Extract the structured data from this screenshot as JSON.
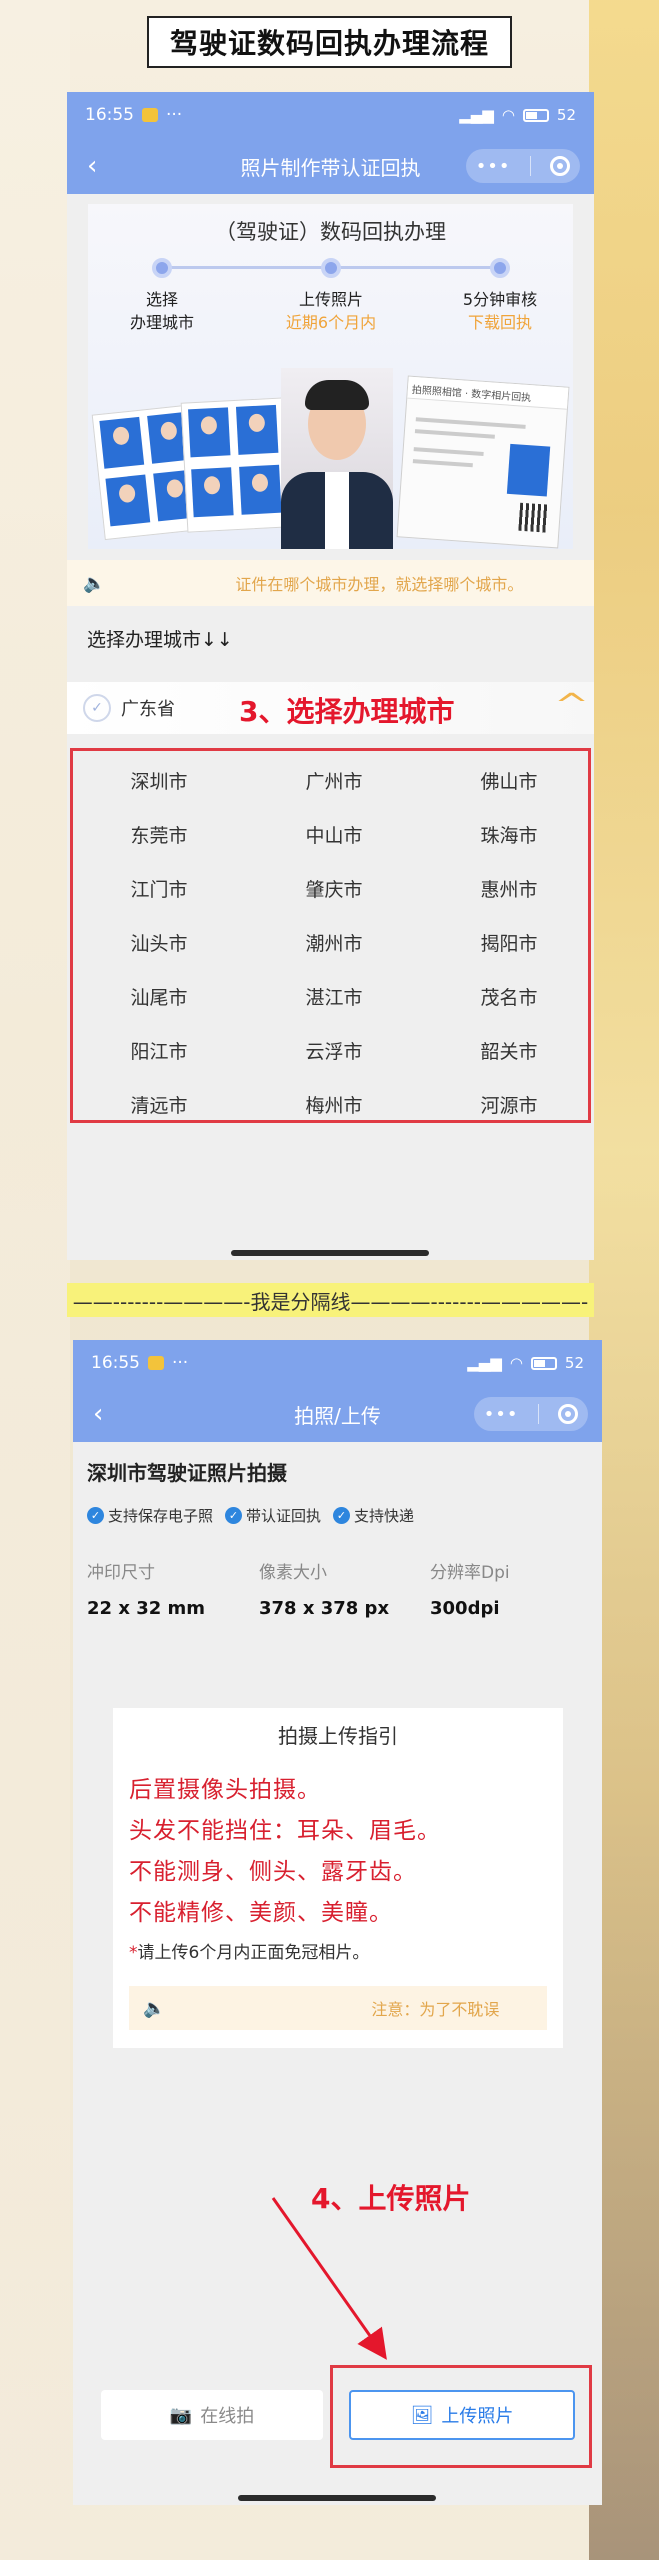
{
  "page_title": "驾驶证数码回执办理流程",
  "screen1": {
    "status": {
      "time": "16:55",
      "more": "···",
      "battery": "52"
    },
    "nav": {
      "back": "‹",
      "title": "照片制作带认证回执",
      "menu": "•••"
    },
    "banner": {
      "title": "（驾驶证）数码回执办理",
      "steps": [
        {
          "main": "选择",
          "sub_main": "办理城市",
          "sub_colored": ""
        },
        {
          "main": "上传照片",
          "sub_main": "",
          "sub_colored": "近期6个月内"
        },
        {
          "main": "5分钟审核",
          "sub_main": "",
          "sub_colored": "下载回执"
        }
      ],
      "card_header": "拍照照相馆 · 数字相片回执"
    },
    "notice": "证件在哪个城市办理，就选择哪个城市。",
    "section_label": "选择办理城市↓↓",
    "province": "广东省",
    "annotation": "3、选择办理城市",
    "cities": [
      [
        "深圳市",
        "广州市",
        "佛山市"
      ],
      [
        "东莞市",
        "中山市",
        "珠海市"
      ],
      [
        "江门市",
        "肇庆市",
        "惠州市"
      ],
      [
        "汕头市",
        "潮州市",
        "揭阳市"
      ],
      [
        "汕尾市",
        "湛江市",
        "茂名市"
      ],
      [
        "阳江市",
        "云浮市",
        "韶关市"
      ],
      [
        "清远市",
        "梅州市",
        "河源市"
      ]
    ]
  },
  "separator": "——-------————-我是分隔线————-------—————-",
  "screen2": {
    "status": {
      "time": "16:55",
      "more": "···",
      "battery": "52"
    },
    "nav": {
      "back": "‹",
      "title": "拍照/上传",
      "menu": "•••"
    },
    "title": "深圳市驾驶证照片拍摄",
    "tags": [
      "支持保存电子照",
      "带认证回执",
      "支持快递"
    ],
    "specs": [
      {
        "label": "冲印尺寸",
        "value": "22 x 32 mm"
      },
      {
        "label": "像素大小",
        "value": "378 x 378 px"
      },
      {
        "label": "分辨率Dpi",
        "value": "300dpi"
      }
    ],
    "guide": {
      "title": "拍摄上传指引",
      "lines": [
        "后置摄像头拍摄。",
        "头发不能挡住：耳朵、眉毛。",
        "不能测身、侧头、露牙齿。",
        "不能精修、美颜、美瞳。"
      ],
      "small_star": "*",
      "small": "请上传6个月内正面免冠相片。",
      "notice": "注意：为了不耽误"
    },
    "annotation": "4、上传照片",
    "buttons": {
      "online": "在线拍",
      "upload": "上传照片"
    }
  }
}
